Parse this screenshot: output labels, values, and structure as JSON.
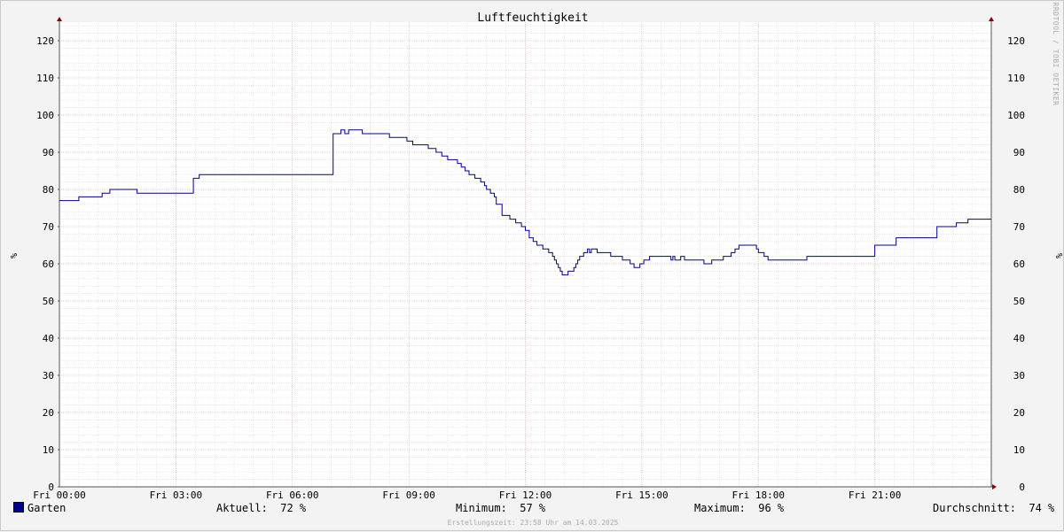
{
  "chart_data": {
    "type": "line",
    "title": "Luftfeuchtigkeit",
    "ylabel": "%",
    "ylim": [
      0,
      125
    ],
    "yticks": [
      0,
      10,
      20,
      30,
      40,
      50,
      60,
      70,
      80,
      90,
      100,
      110,
      120
    ],
    "xlim": [
      0,
      24
    ],
    "xticks": [
      {
        "x": 0,
        "label": "Fri 00:00"
      },
      {
        "x": 3,
        "label": "Fri 03:00"
      },
      {
        "x": 6,
        "label": "Fri 06:00"
      },
      {
        "x": 9,
        "label": "Fri 09:00"
      },
      {
        "x": 12,
        "label": "Fri 12:00"
      },
      {
        "x": 15,
        "label": "Fri 15:00"
      },
      {
        "x": 18,
        "label": "Fri 18:00"
      },
      {
        "x": 21,
        "label": "Fri 21:00"
      }
    ],
    "grid": true,
    "series": [
      {
        "name": "Garten",
        "color": "#00008b",
        "step": true,
        "points": [
          [
            0,
            77
          ],
          [
            0.5,
            78
          ],
          [
            1.1,
            79
          ],
          [
            1.3,
            80
          ],
          [
            2.0,
            79
          ],
          [
            3.45,
            83
          ],
          [
            3.6,
            84
          ],
          [
            7.05,
            95
          ],
          [
            7.25,
            96
          ],
          [
            7.35,
            95
          ],
          [
            7.45,
            96
          ],
          [
            7.8,
            95
          ],
          [
            8.5,
            94
          ],
          [
            8.95,
            93
          ],
          [
            9.1,
            92
          ],
          [
            9.5,
            91
          ],
          [
            9.7,
            90
          ],
          [
            9.85,
            89
          ],
          [
            10.0,
            88
          ],
          [
            10.25,
            87
          ],
          [
            10.35,
            86
          ],
          [
            10.45,
            85
          ],
          [
            10.55,
            84
          ],
          [
            10.7,
            83
          ],
          [
            10.85,
            82
          ],
          [
            10.95,
            81
          ],
          [
            11.0,
            80
          ],
          [
            11.1,
            79
          ],
          [
            11.2,
            78
          ],
          [
            11.25,
            76
          ],
          [
            11.4,
            73
          ],
          [
            11.6,
            72
          ],
          [
            11.75,
            71
          ],
          [
            11.9,
            70
          ],
          [
            12.0,
            69
          ],
          [
            12.1,
            67
          ],
          [
            12.2,
            66
          ],
          [
            12.3,
            65
          ],
          [
            12.45,
            64
          ],
          [
            12.6,
            63
          ],
          [
            12.7,
            62
          ],
          [
            12.75,
            61
          ],
          [
            12.8,
            60
          ],
          [
            12.85,
            59
          ],
          [
            12.9,
            58
          ],
          [
            12.95,
            57
          ],
          [
            13.1,
            58
          ],
          [
            13.25,
            59
          ],
          [
            13.3,
            60
          ],
          [
            13.35,
            61
          ],
          [
            13.4,
            62
          ],
          [
            13.5,
            63
          ],
          [
            13.6,
            64
          ],
          [
            13.65,
            63
          ],
          [
            13.7,
            64
          ],
          [
            13.85,
            63
          ],
          [
            14.2,
            62
          ],
          [
            14.5,
            61
          ],
          [
            14.7,
            60
          ],
          [
            14.8,
            59
          ],
          [
            14.95,
            60
          ],
          [
            15.05,
            61
          ],
          [
            15.2,
            62
          ],
          [
            15.75,
            61
          ],
          [
            15.8,
            62
          ],
          [
            15.85,
            61
          ],
          [
            15.95,
            61
          ],
          [
            16.0,
            62
          ],
          [
            16.1,
            61
          ],
          [
            16.6,
            60
          ],
          [
            16.8,
            61
          ],
          [
            17.1,
            62
          ],
          [
            17.3,
            63
          ],
          [
            17.4,
            64
          ],
          [
            17.5,
            65
          ],
          [
            17.95,
            64
          ],
          [
            18.0,
            63
          ],
          [
            18.15,
            62
          ],
          [
            18.25,
            61
          ],
          [
            19.25,
            62
          ],
          [
            21.0,
            65
          ],
          [
            21.55,
            67
          ],
          [
            22.6,
            70
          ],
          [
            23.1,
            71
          ],
          [
            23.4,
            72
          ],
          [
            24.0,
            72
          ]
        ]
      }
    ]
  },
  "legend": {
    "series_name": "Garten",
    "aktuell": "Aktuell:  72 %",
    "minimum": "Minimum:  57 %",
    "maximum": "Maximum:  96 %",
    "durchschnitt": "Durchschnitt:  74 %"
  },
  "watermark": "RRDTOOL / TOBI OETIKER",
  "footer": "Erstellungszeit: 23:58 Uhr am 14.03.2025"
}
